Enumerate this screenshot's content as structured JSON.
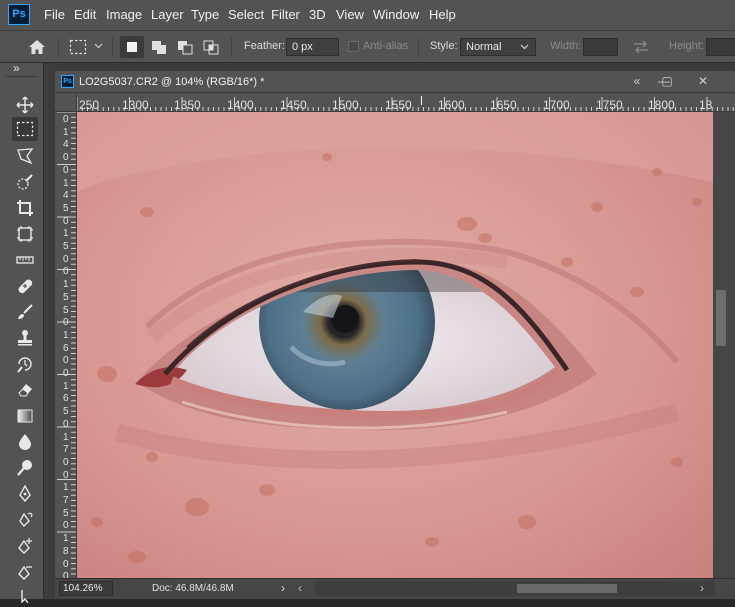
{
  "app": {
    "logo_text": "Ps",
    "menu": [
      "File",
      "Edit",
      "Image",
      "Layer",
      "Type",
      "Select",
      "Filter",
      "3D",
      "View",
      "Window",
      "Help"
    ]
  },
  "options_bar": {
    "feather_label": "Feather:",
    "feather_value": "0 px",
    "antialias_label": "Anti-alias",
    "style_label": "Style:",
    "style_value": "Normal",
    "width_label": "Width:",
    "height_label": "Height:"
  },
  "toolbar": {
    "collapse_glyph": "»",
    "tools": [
      "move-icon",
      "rectangular-marquee-icon",
      "lasso-icon",
      "quick-selection-icon",
      "crop-icon",
      "frame-icon",
      "ruler-icon",
      "healing-brush-icon",
      "brush-icon",
      "clone-stamp-icon",
      "history-brush-icon",
      "eraser-icon",
      "gradient-icon",
      "blur-icon",
      "dodge-icon",
      "pen-icon",
      "freeform-pen-icon",
      "add-anchor-point-icon",
      "delete-anchor-point-icon"
    ]
  },
  "document": {
    "tab_icon_text": "Ps",
    "title": "LO2G5037.CR2 @ 104% (RGB/16*) *",
    "window_buttons": {
      "collapse": "«",
      "minimize": "—",
      "maximize": "▢",
      "close": "✕"
    },
    "ruler_h_labels": [
      "250",
      "1300",
      "1350",
      "1400",
      "1450",
      "1500",
      "1550",
      "1600",
      "1650",
      "1700",
      "1750",
      "1800",
      "18"
    ],
    "ruler_v_labels": [
      "0",
      "1",
      "4",
      "0",
      "0",
      "1",
      "4",
      "5",
      "0",
      "1",
      "5",
      "0",
      "0",
      "1",
      "5",
      "5",
      "0",
      "1",
      "6",
      "0",
      "0",
      "1",
      "6",
      "5",
      "0",
      "1",
      "7",
      "0",
      "0",
      "1",
      "7",
      "5",
      "0",
      "1",
      "8",
      "0",
      "0",
      "1",
      "8"
    ]
  },
  "status": {
    "zoom": "104.26%",
    "doc_size": "Doc: 46.8M/46.8M",
    "arrow_right": "›",
    "scroll_left": "‹",
    "scroll_right": "›"
  },
  "colors": {
    "ui_dark": "#535353",
    "skin": "#d79a96",
    "iris": "#4e6f86"
  }
}
